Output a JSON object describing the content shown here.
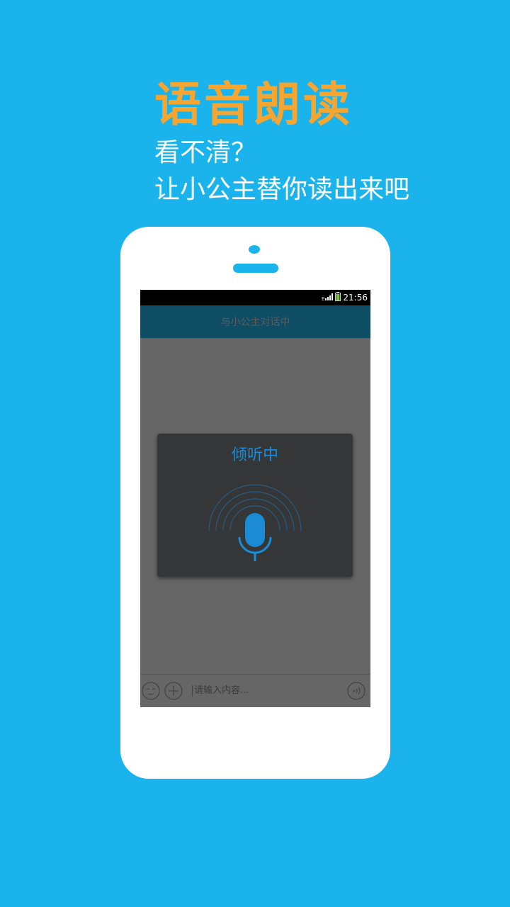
{
  "colors": {
    "background": "#1AB3EB",
    "headline": "#F7A531",
    "accent": "#1B8BD6",
    "appbar": "#0F4D64",
    "dialog": "#353637",
    "appbar_title": "#5C5C5C",
    "icon_outline": "#444444"
  },
  "promo": {
    "headline": "语音朗读",
    "line1": "看不清？",
    "line2": "让小公主替你读出来吧"
  },
  "status_bar": {
    "time": "21:56",
    "icons": [
      "signal-icon",
      "battery-icon"
    ]
  },
  "app_bar": {
    "title": "与小公主对话中"
  },
  "voice_dialog": {
    "title": "倾听中",
    "icon": "microphone-icon"
  },
  "input_bar": {
    "placeholder": "请输入内容...",
    "icons": [
      "emoji-icon",
      "add-icon",
      "voice-icon"
    ]
  }
}
